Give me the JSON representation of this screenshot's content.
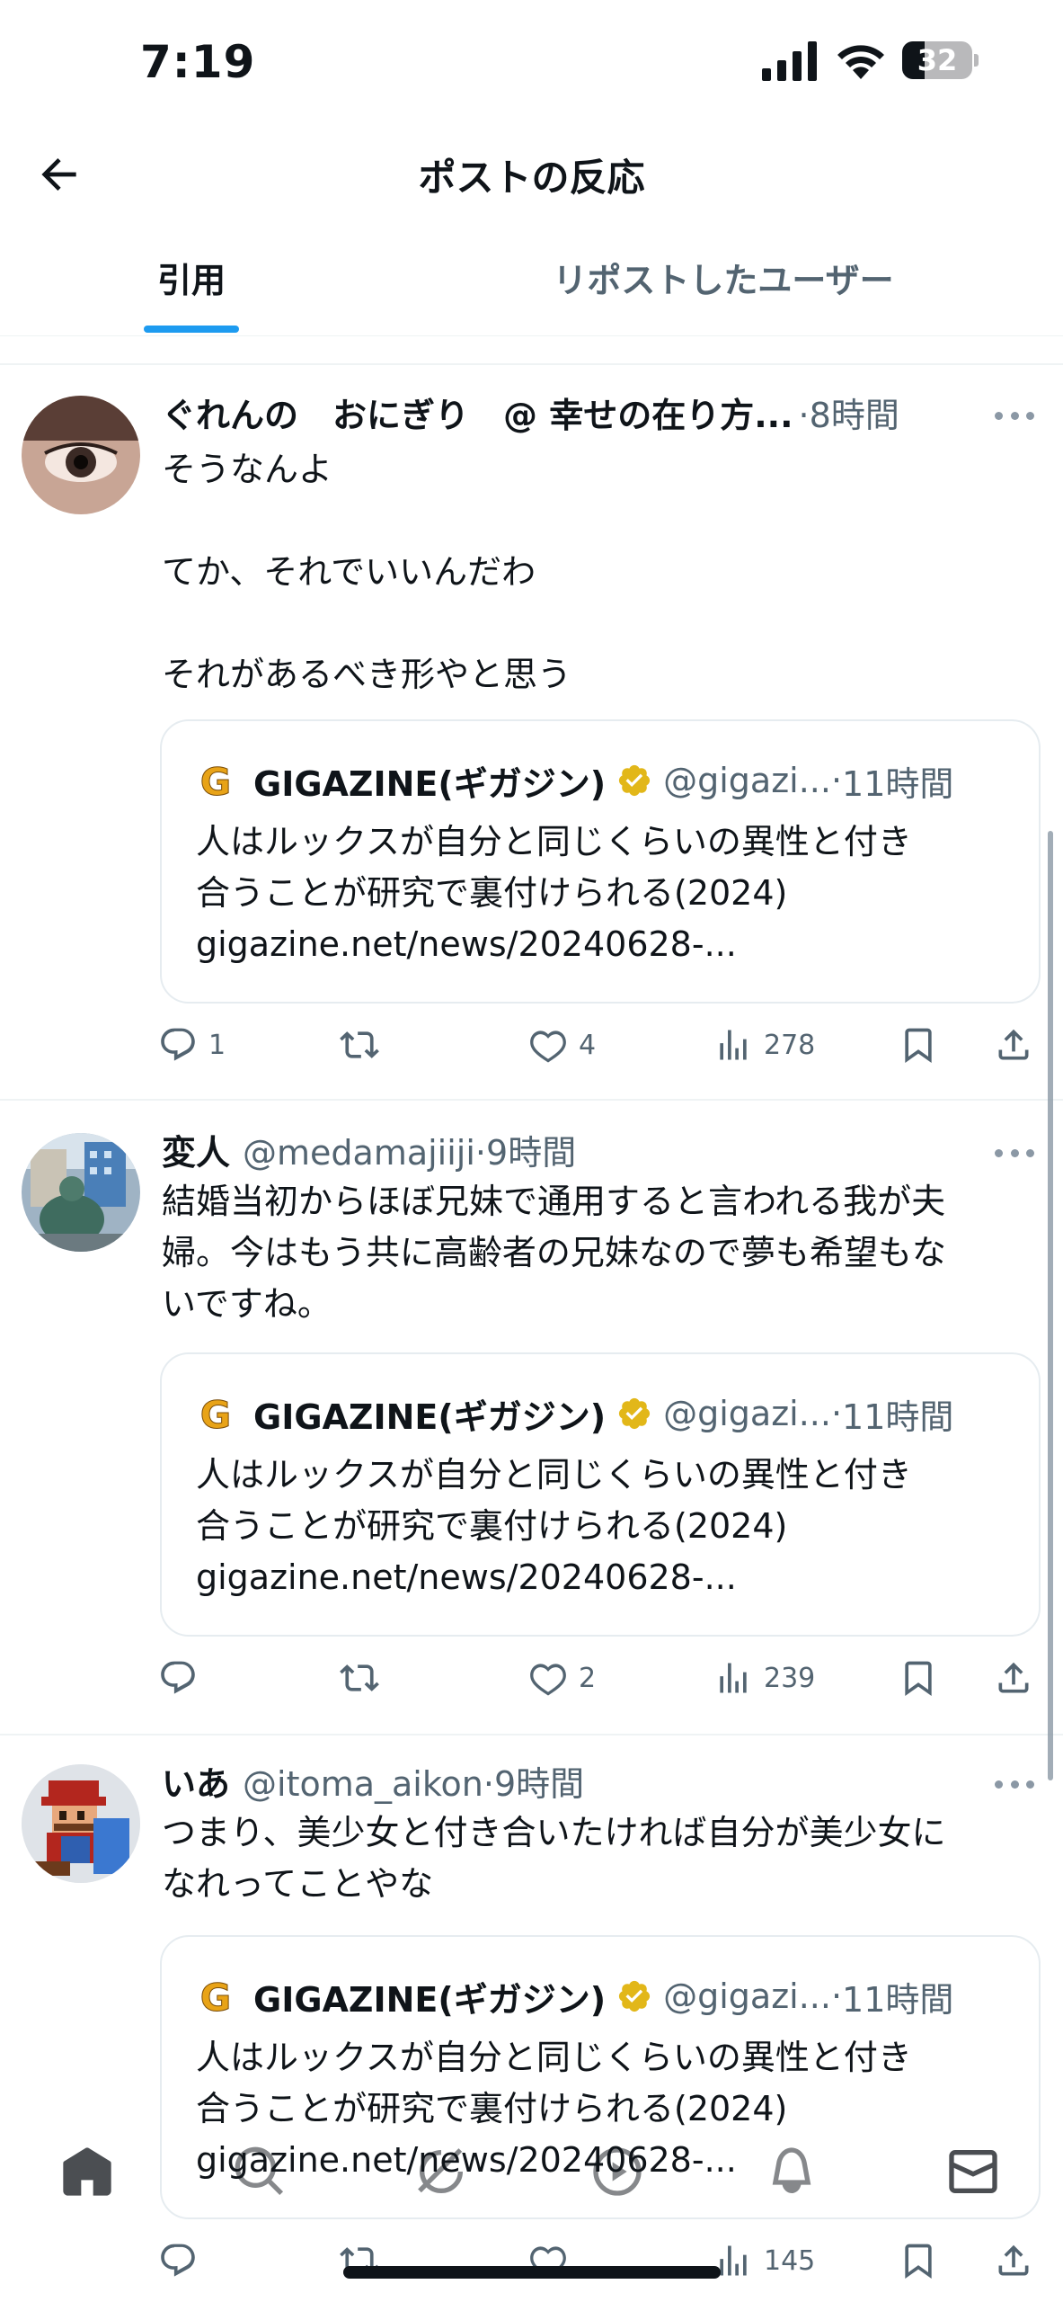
{
  "status_bar": {
    "time": "7:19",
    "battery": "32",
    "battery_level": 0.32
  },
  "header": {
    "title": "ポストの反応"
  },
  "tabs": [
    {
      "label": "引用",
      "selected": true
    },
    {
      "label": "リポストしたユーザー",
      "selected": false
    }
  ],
  "colors": {
    "accent": "#1d9bf0",
    "text": "#0f1419",
    "secondary": "#536471",
    "verified": "#e2b719",
    "gigazine": "#e8a317"
  },
  "quoted": {
    "name": "GIGAZINE(ギガジン)",
    "handle": "@gigazi...",
    "dot": "·",
    "time": "11時間",
    "text": "人はルックスが自分と同じくらいの異性と付き\n合うことが研究で裏付けられる(2024)\ngigazine.net/news/20240628-...",
    "logo_icon": "gigazine-g-logo",
    "verified_icon": "verified-badge-icon"
  },
  "posts": [
    {
      "name": "ぐれんの　おにぎり　@ 幸せの在り方...",
      "handle": "",
      "dot": "·",
      "time": "8時間",
      "text": "そうなんよ\n\nてか、それでいいんだわ\n\nそれがあるべき形やと思う",
      "replies": "1",
      "reposts": "",
      "likes": "4",
      "views": "278"
    },
    {
      "name": "変人",
      "handle": "@medamajiiji",
      "dot": "·",
      "time": "9時間",
      "text": "結婚当初からほぼ兄妹で通用すると言われる我が夫\n婦。今はもう共に高齢者の兄妹なので夢も希望もな\nいですね。",
      "replies": "",
      "reposts": "",
      "likes": "2",
      "views": "239"
    },
    {
      "name": "いあ",
      "handle": "@itoma_aikon",
      "dot": "·",
      "time": "9時間",
      "text": "つまり、美少女と付き合いたければ自分が美少女に\nなれってことやな",
      "replies": "",
      "reposts": "",
      "likes": "",
      "views": "145"
    }
  ],
  "bottom_nav": [
    "home-icon",
    "search-icon",
    "grok-icon",
    "spaces-icon",
    "notifications-icon",
    "messages-icon"
  ]
}
